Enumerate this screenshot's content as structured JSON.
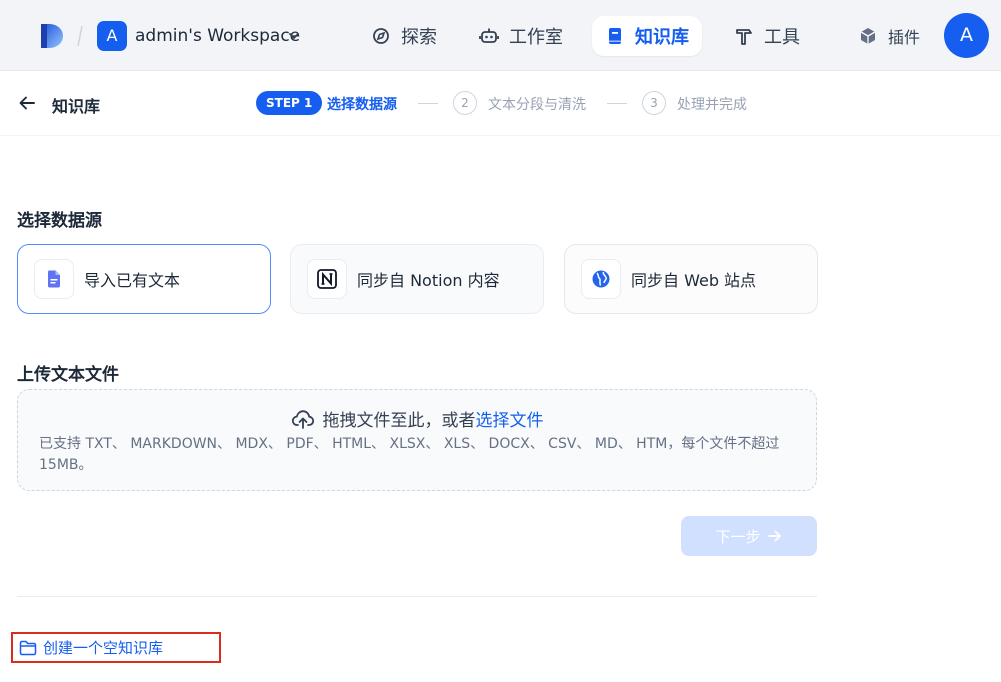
{
  "topbar": {
    "workspace_initial": "A",
    "workspace_name": "admin's Workspace",
    "nav": [
      {
        "label": "探索",
        "icon": "compass-icon",
        "active": false
      },
      {
        "label": "工作室",
        "icon": "robot-icon",
        "active": false
      },
      {
        "label": "知识库",
        "icon": "book-icon",
        "active": true
      },
      {
        "label": "工具",
        "icon": "hammer-icon",
        "active": false
      },
      {
        "label": "插件",
        "icon": "cube-icon",
        "active": false
      }
    ],
    "user_initial": "A",
    "accent": "#155eef"
  },
  "stephead": {
    "title": "知识库",
    "steps": [
      {
        "badge": "STEP 1",
        "label": "选择数据源",
        "state": "active"
      },
      {
        "num": "2",
        "label": "文本分段与清洗",
        "state": "pending"
      },
      {
        "num": "3",
        "label": "处理并完成",
        "state": "pending"
      }
    ]
  },
  "datasource": {
    "title": "选择数据源",
    "options": [
      {
        "label": "导入已有文本",
        "icon": "file-text-icon",
        "selected": true
      },
      {
        "label": "同步自 Notion 内容",
        "icon": "notion-icon",
        "selected": false
      },
      {
        "label": "同步自 Web 站点",
        "icon": "globe-icon",
        "selected": false
      }
    ]
  },
  "upload": {
    "title": "上传文本文件",
    "drag_text": "拖拽文件至此，或者",
    "select_link": "选择文件",
    "hint": "已支持 TXT、 MARKDOWN、 MDX、 PDF、 HTML、 XLSX、 XLS、 DOCX、 CSV、 MD、 HTM，每个文件不超过 15MB。"
  },
  "next_button": "下一步",
  "create_empty": "创建一个空知识库"
}
